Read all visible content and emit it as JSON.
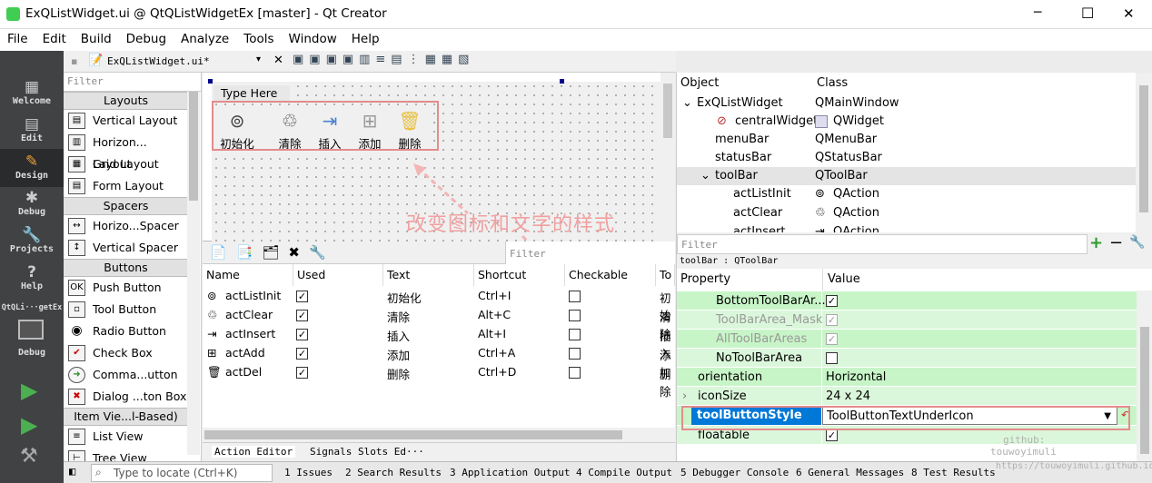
{
  "window": {
    "title": "ExQListWidget.ui @ QtQListWidgetEx [master] - Qt Creator",
    "min": "─",
    "max": "☐",
    "close": "✕"
  },
  "menu": [
    "File",
    "Edit",
    "Build",
    "Debug",
    "Analyze",
    "Tools",
    "Window",
    "Help"
  ],
  "modes": [
    {
      "label": "Welcome",
      "icon": "▦"
    },
    {
      "label": "Edit",
      "icon": "▤"
    },
    {
      "label": "Design",
      "icon": "✎"
    },
    {
      "label": "Debug",
      "icon": "✱"
    },
    {
      "label": "Projects",
      "icon": "🔧"
    },
    {
      "label": "Help",
      "icon": "?"
    }
  ],
  "project_label": "QtQLi···getEx",
  "debug_target_label": "Debug",
  "doc": {
    "filename": "ExQListWidget.ui*"
  },
  "widgetbox": {
    "filter": "Filter",
    "cats": [
      "Layouts",
      "Spacers",
      "Buttons",
      "Item Vie...l-Based)"
    ],
    "layouts": [
      {
        "label": "Vertical Layout",
        "icon": "▤"
      },
      {
        "label": "Horizon... Layout",
        "icon": "▥"
      },
      {
        "label": "Grid Layout",
        "icon": "▦"
      },
      {
        "label": "Form Layout",
        "icon": "▤"
      }
    ],
    "spacers": [
      {
        "label": "Horizo...Spacer",
        "icon": "↔"
      },
      {
        "label": "Vertical Spacer",
        "icon": "↕"
      }
    ],
    "buttons": [
      {
        "label": "Push Button",
        "icon": "OK"
      },
      {
        "label": "Tool Button",
        "icon": "▫"
      },
      {
        "label": "Radio Button",
        "icon": "◉"
      },
      {
        "label": "Check Box",
        "icon": "✔"
      },
      {
        "label": "Comma...utton",
        "icon": "➜"
      },
      {
        "label": "Dialog ...ton Box",
        "icon": "✖"
      }
    ],
    "itemviews": [
      {
        "label": "List View",
        "icon": "≡"
      },
      {
        "label": "Tree View",
        "icon": "⊢"
      }
    ]
  },
  "form": {
    "type_here": "Type Here",
    "toolbar": [
      {
        "label": "初始化",
        "icon": "⊚"
      },
      {
        "label": "清除",
        "icon": "♲"
      },
      {
        "label": "插入",
        "icon": "⇥"
      },
      {
        "label": "添加",
        "icon": "⊞"
      },
      {
        "label": "删除",
        "icon": "🗑"
      }
    ]
  },
  "annotation": "改变图标和文字的样式",
  "action_editor": {
    "filter": "Filter",
    "headers": [
      "Name",
      "Used",
      "Text",
      "Shortcut",
      "Checkable",
      "To"
    ],
    "rows": [
      {
        "name": "actListInit",
        "icon": "⊚",
        "used": "✓",
        "text": "初始化",
        "shortcut": "Ctrl+I",
        "checkable": "",
        "tip": "初始"
      },
      {
        "name": "actClear",
        "icon": "♲",
        "used": "✓",
        "text": "清除",
        "shortcut": "Alt+C",
        "checkable": "",
        "tip": "清除"
      },
      {
        "name": "actInsert",
        "icon": "⇥",
        "used": "✓",
        "text": "插入",
        "shortcut": "Alt+I",
        "checkable": "",
        "tip": "插入"
      },
      {
        "name": "actAdd",
        "icon": "⊞",
        "used": "✓",
        "text": "添加",
        "shortcut": "Ctrl+A",
        "checkable": "",
        "tip": "添加"
      },
      {
        "name": "actDel",
        "icon": "🗑",
        "used": "✓",
        "text": "删除",
        "shortcut": "Ctrl+D",
        "checkable": "",
        "tip": "删除"
      }
    ],
    "tabs": [
      "Action Editor",
      "Signals  Slots Ed···"
    ]
  },
  "object_inspector": {
    "headers": [
      "Object",
      "Class"
    ],
    "rows": [
      {
        "obj": "ExQListWidget",
        "cls": "QMainWindow",
        "arrow": "⌄"
      },
      {
        "obj": "centralWidget",
        "cls": "QWidget",
        "arrow": ""
      },
      {
        "obj": "menuBar",
        "cls": "QMenuBar",
        "arrow": ""
      },
      {
        "obj": "statusBar",
        "cls": "QStatusBar",
        "arrow": ""
      },
      {
        "obj": "toolBar",
        "cls": "QToolBar",
        "arrow": "⌄"
      },
      {
        "obj": "actListInit",
        "cls": "QAction",
        "arrow": ""
      },
      {
        "obj": "actClear",
        "cls": "QAction",
        "arrow": ""
      },
      {
        "obj": "actInsert",
        "cls": "QAction",
        "arrow": ""
      }
    ]
  },
  "property_editor": {
    "filter": "Filter",
    "context": "toolBar : QToolBar",
    "headers": [
      "Property",
      "Value"
    ],
    "rows": [
      {
        "name": "BottomToolBarAr...",
        "value": "✓",
        "kind": "cb"
      },
      {
        "name": "ToolBarArea_Mask",
        "value": "✓",
        "kind": "cb",
        "dim": true
      },
      {
        "name": "AllToolBarAreas",
        "value": "✓",
        "kind": "cb",
        "dim": true
      },
      {
        "name": "NoToolBarArea",
        "value": "",
        "kind": "cb"
      },
      {
        "name": "orientation",
        "value": "Horizontal",
        "kind": "text"
      },
      {
        "name": "iconSize",
        "value": "24 x 24",
        "kind": "text"
      },
      {
        "name": "toolButtonStyle",
        "value": "ToolButtonTextUnderIcon",
        "kind": "combo"
      },
      {
        "name": "floatable",
        "value": "✓",
        "kind": "cb"
      }
    ]
  },
  "statusbar": {
    "locate": "Type to locate (Ctrl+K)",
    "panes": [
      "1 Issues",
      "2 Search Results",
      "3 Application Output",
      "4 Compile Output",
      "5 Debugger Console",
      "6 General Messages",
      "8 Test Results"
    ]
  },
  "watermark": {
    "line1": "github:",
    "line2": "touwoyimuli",
    "line3": "https://touwoyimuli.github.io"
  }
}
